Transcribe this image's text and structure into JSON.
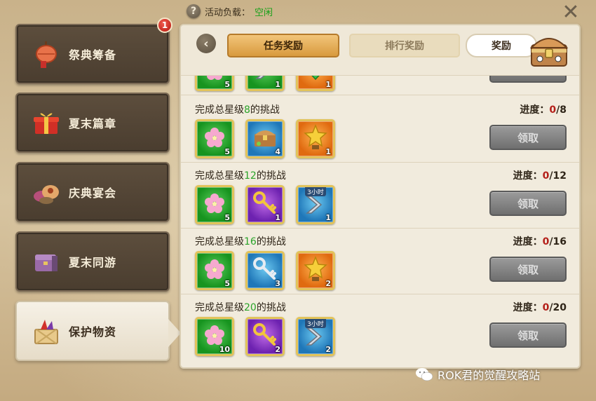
{
  "status": {
    "label": "活动负载：",
    "value": "空闲"
  },
  "nav": [
    {
      "label": "祭典筹备",
      "icon": "lantern-icon",
      "badge": "1",
      "active": false
    },
    {
      "label": "夏末篇章",
      "icon": "gift-box-icon",
      "active": false
    },
    {
      "label": "庆典宴会",
      "icon": "feast-food-icon",
      "active": false
    },
    {
      "label": "夏末同游",
      "icon": "travel-chest-icon",
      "active": false
    },
    {
      "label": "保护物资",
      "icon": "supply-crate-icon",
      "active": true
    }
  ],
  "tabs": {
    "task_rewards": "任务奖励",
    "rank_rewards": "排行奖励",
    "rewards": "奖励"
  },
  "partial_row": {
    "counts": [
      "5",
      "1",
      "1"
    ],
    "claim": "领取"
  },
  "rows": [
    {
      "title_prefix": "完成总星级",
      "stars": "8",
      "title_suffix": "的挑战",
      "progress_label": "进度：",
      "progress_current": "0",
      "progress_total": "/8",
      "claim": "领取",
      "items": [
        {
          "color": "green",
          "icon": "sakura-icon",
          "count": "5"
        },
        {
          "color": "blue",
          "icon": "treasure-chest-icon",
          "count": "4"
        },
        {
          "color": "orange",
          "icon": "gold-star-trophy-icon",
          "count": "1"
        }
      ]
    },
    {
      "title_prefix": "完成总星级",
      "stars": "12",
      "title_suffix": "的挑战",
      "progress_label": "进度：",
      "progress_current": "0",
      "progress_total": "/12",
      "claim": "领取",
      "items": [
        {
          "color": "green",
          "icon": "sakura-icon",
          "count": "5"
        },
        {
          "color": "purple",
          "icon": "gold-key-icon",
          "count": "1"
        },
        {
          "color": "blue",
          "icon": "speedup-icon",
          "count": "1",
          "tag": "3小时"
        }
      ]
    },
    {
      "title_prefix": "完成总星级",
      "stars": "16",
      "title_suffix": "的挑战",
      "progress_label": "进度：",
      "progress_current": "0",
      "progress_total": "/16",
      "claim": "领取",
      "items": [
        {
          "color": "green",
          "icon": "sakura-icon",
          "count": "5"
        },
        {
          "color": "blue",
          "icon": "silver-key-icon",
          "count": "3"
        },
        {
          "color": "orange",
          "icon": "gold-star-trophy-icon",
          "count": "2"
        }
      ]
    },
    {
      "title_prefix": "完成总星级",
      "stars": "20",
      "title_suffix": "的挑战",
      "progress_label": "进度：",
      "progress_current": "0",
      "progress_total": "/20",
      "claim": "领取",
      "items": [
        {
          "color": "green",
          "icon": "sakura-icon",
          "count": "10"
        },
        {
          "color": "purple",
          "icon": "gold-key-icon",
          "count": "2"
        },
        {
          "color": "blue",
          "icon": "speedup-icon",
          "count": "2",
          "tag": "3小时"
        }
      ]
    }
  ],
  "watermark": "ROK君的觉醒攻略站",
  "colors": {
    "accent_tab": "#d89a3e",
    "star_green": "#2aa42a",
    "progress_red": "#b4201a",
    "claim_disabled": "#7d7d7d"
  }
}
